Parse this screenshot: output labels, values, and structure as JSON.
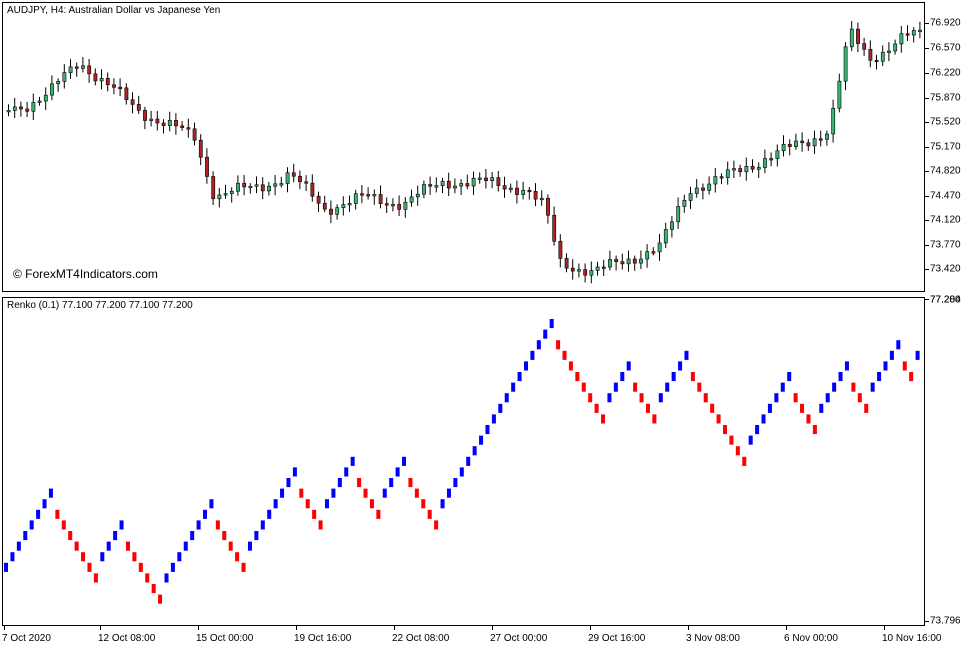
{
  "top_pane": {
    "title": "AUDJPY, H4:  Australian Dollar vs Japanese Yen",
    "watermark": "© ForexMT4Indicators.com",
    "price_labels": [
      "76.920",
      "76.570",
      "76.220",
      "75.870",
      "75.520",
      "75.170",
      "74.820",
      "74.470",
      "74.120",
      "73.770",
      "73.420"
    ]
  },
  "bottom_pane": {
    "title": "Renko (0.1) 77.100 77.200 77.100 77.200",
    "price_labels": [
      "77.284",
      "77.200",
      "73.796"
    ]
  },
  "time_axis": {
    "labels": [
      "7 Oct 2020",
      "12 Oct 08:00",
      "15 Oct 00:00",
      "19 Oct 16:00",
      "22 Oct 08:00",
      "27 Oct 00:00",
      "29 Oct 16:00",
      "3 Nov 08:00",
      "6 Nov 00:00",
      "10 Nov 16:00"
    ]
  },
  "colors": {
    "bull_candle": "#3cb371",
    "bear_candle": "#b22222",
    "renko_up": "#0000ff",
    "renko_down": "#ff0000"
  }
}
